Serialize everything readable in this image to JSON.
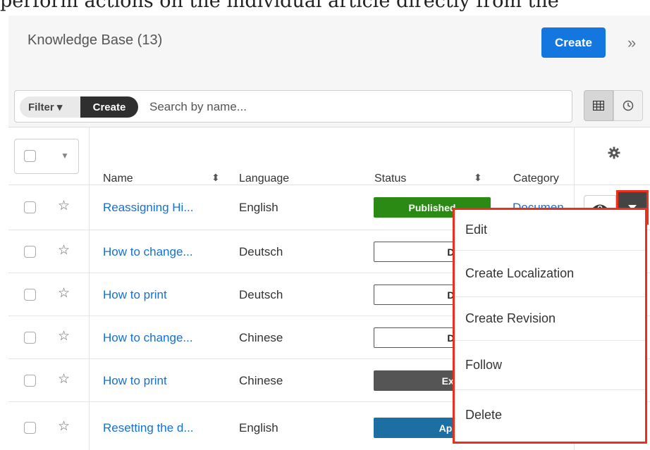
{
  "caption_text": "perform actions on the individual article directly from the",
  "header": {
    "title": "Knowledge Base (13)",
    "create_label": "Create",
    "expand_icon": "»"
  },
  "filter": {
    "filter_label": "Filter ▾",
    "create_label": "Create",
    "search_placeholder": "Search by name..."
  },
  "columns": {
    "name": "Name",
    "language": "Language",
    "status": "Status",
    "category": "Category"
  },
  "rows": [
    {
      "name": "Reassigning Hi...",
      "language": "English",
      "status": "Published",
      "category": "Documen"
    },
    {
      "name": "How to change...",
      "language": "Deutsch",
      "status": "Draft",
      "category": ""
    },
    {
      "name": "How to print",
      "language": "Deutsch",
      "status": "Draft",
      "category": ""
    },
    {
      "name": "How to change...",
      "language": "Chinese",
      "status": "Draft",
      "category": ""
    },
    {
      "name": "How to print",
      "language": "Chinese",
      "status": "Expired",
      "category": ""
    },
    {
      "name": "Resetting the d...",
      "language": "English",
      "status": "Approved",
      "category": ""
    }
  ],
  "menu": [
    "Edit",
    "Create Localization",
    "Create Revision",
    "Follow",
    "Delete"
  ],
  "colors": {
    "accent": "#1477e0",
    "published": "#2b8a13",
    "approved": "#1b6fa3",
    "expired": "#555555",
    "highlight": "#e8301c"
  },
  "icons": [
    "chevron-double-right-icon",
    "grid-view-icon",
    "clock-icon",
    "gear-icon",
    "eye-icon",
    "caret-down-icon",
    "star-icon",
    "sort-icon"
  ]
}
